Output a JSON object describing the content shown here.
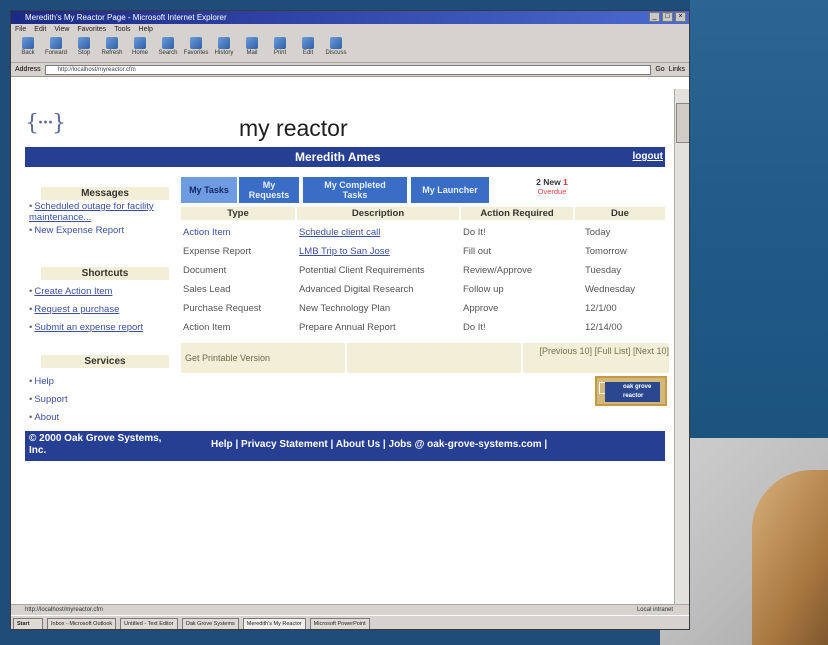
{
  "window": {
    "title": "Meredith's My Reactor Page - Microsoft Internet Explorer"
  },
  "menu": [
    "File",
    "Edit",
    "View",
    "Favorites",
    "Tools",
    "Help"
  ],
  "toolbar": [
    "Back",
    "Forward",
    "Stop",
    "Refresh",
    "Home",
    "Search",
    "Favorites",
    "History",
    "Mail",
    "Print",
    "Edit",
    "Discuss"
  ],
  "address": {
    "label": "Address",
    "value": "http://localhost/myreactor.cfm",
    "go": "Go",
    "links": "Links"
  },
  "page": {
    "title": "my reactor",
    "logo": "{···}",
    "user_name": "Meredith Ames",
    "logout": "logout"
  },
  "sidebar": {
    "messages_header": "Messages",
    "messages": [
      {
        "label": "Scheduled outage for facility maintenance..."
      },
      {
        "label": "New Expense Report"
      }
    ],
    "shortcuts_header": "Shortcuts",
    "shortcuts": [
      {
        "label": "Create Action Item"
      },
      {
        "label": "Request a purchase"
      },
      {
        "label": "Submit an expense report"
      }
    ],
    "services_header": "Services",
    "services": [
      {
        "label": "Help"
      },
      {
        "label": "Support"
      },
      {
        "label": "About"
      }
    ]
  },
  "tabs": [
    {
      "label": "My Tasks"
    },
    {
      "label": "My Requests"
    },
    {
      "label": "My Completed Tasks"
    },
    {
      "label": "My Launcher"
    }
  ],
  "new_count": {
    "count": "2 New",
    "one": "1",
    "overdue": "Overdue"
  },
  "tasks": {
    "columns": [
      "Type",
      "Description",
      "Action Required",
      "Due"
    ],
    "rows": [
      {
        "type": "Action Item",
        "description": "Schedule client call",
        "action": "Do It!",
        "due": "Today"
      },
      {
        "type": "Expense Report",
        "description": "LMB Trip to San Jose",
        "action": "Fill out",
        "due": "Tomorrow"
      },
      {
        "type": "Document",
        "description": "Potential Client Requirements",
        "action": "Review/Approve",
        "due": "Tuesday"
      },
      {
        "type": "Sales Lead",
        "description": "Advanced Digital Research",
        "action": "Follow up",
        "due": "Wednesday"
      },
      {
        "type": "Purchase Request",
        "description": "New Technology Plan",
        "action": "Approve",
        "due": "12/1/00"
      },
      {
        "type": "Action Item",
        "description": "Prepare Annual Report",
        "action": "Do It!",
        "due": "12/14/00"
      }
    ],
    "printable": "Get Printable Version",
    "pager": "[Previous 10] [Full List] [Next 10]"
  },
  "powered_badge": "oak grove reactor",
  "footer": {
    "copyright": "© 2000 Oak Grove Systems, Inc.",
    "links": "Help  |  Privacy Statement  |  About Us  |  Jobs @ oak-grove-systems.com |"
  },
  "statusbar": {
    "left": "http://localhost/myreactor.cfm",
    "zone": "Local intranet"
  },
  "taskbar": [
    {
      "label": "Start"
    },
    {
      "label": "Inbox - Microsoft Outlook"
    },
    {
      "label": "Untitled - Text Editor"
    },
    {
      "label": "Oak Grove Systems"
    },
    {
      "label": "Meredith's My Reactor"
    },
    {
      "label": "Microsoft PowerPoint"
    }
  ],
  "colors": {
    "header_blue": "#263f92",
    "tab_blue": "#3a6dc6",
    "cream": "#f3eed7",
    "link_blue": "#3c4fa2",
    "alert_red": "#e44444"
  }
}
